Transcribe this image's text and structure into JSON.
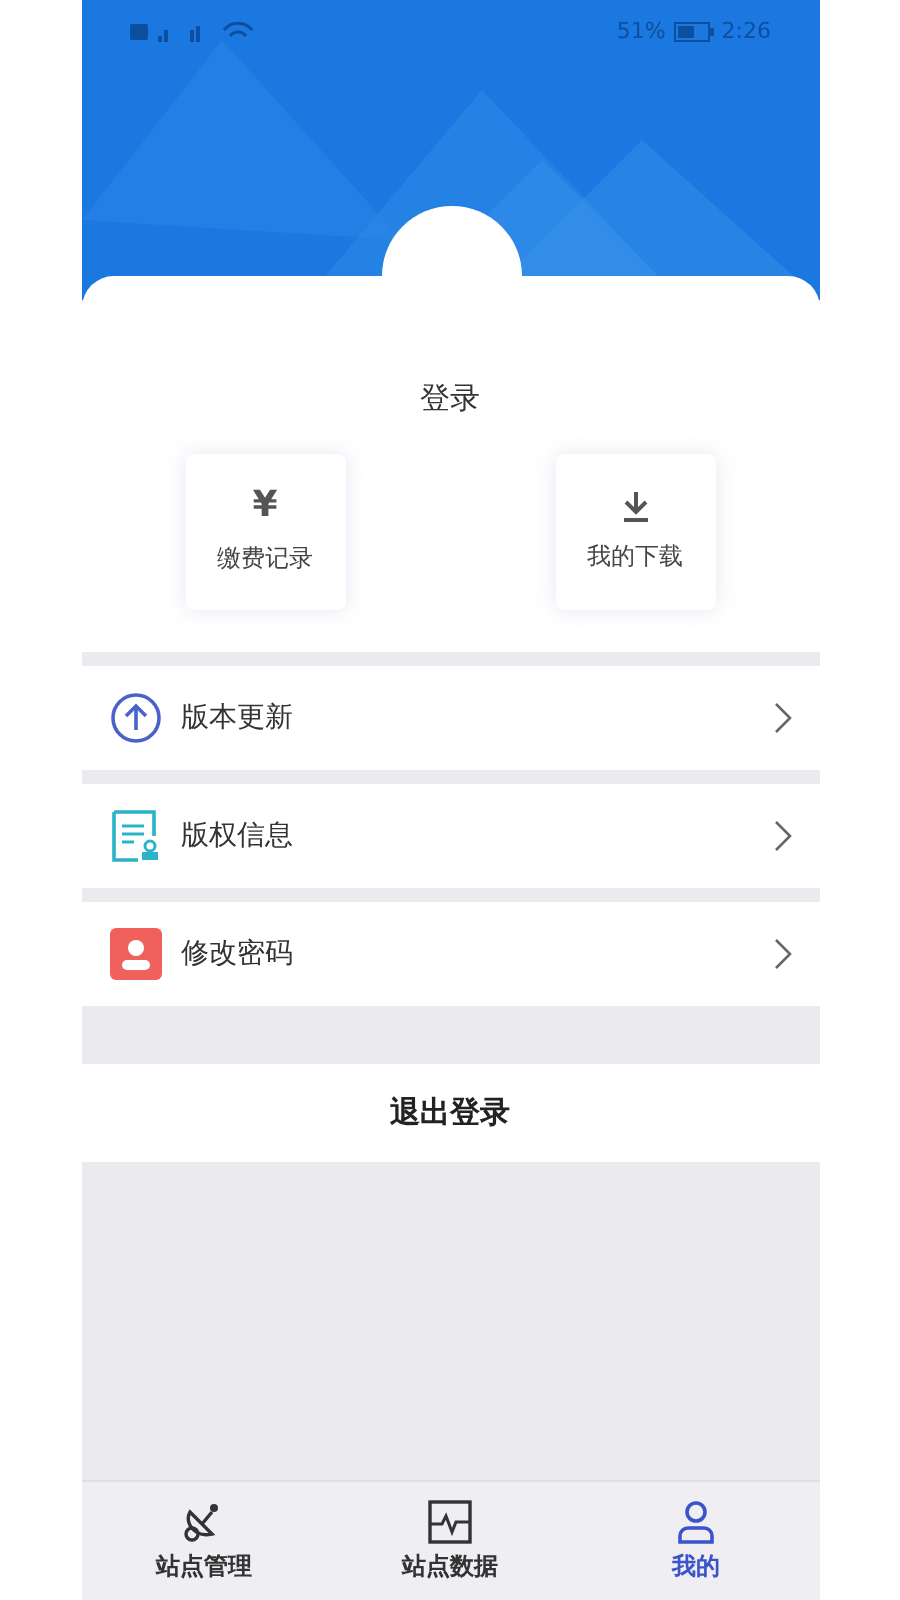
{
  "status_bar": {
    "battery": "51%",
    "time": "2:26"
  },
  "profile": {
    "login": "登录"
  },
  "shortcuts": [
    {
      "kind": "yuan",
      "icon": "¥",
      "label": "缴费记录"
    },
    {
      "kind": "download",
      "label": "我的下载"
    }
  ],
  "menu": [
    {
      "kind": "update",
      "label": "版本更新"
    },
    {
      "kind": "copyright",
      "label": "版权信息"
    },
    {
      "kind": "password",
      "label": "修改密码"
    }
  ],
  "logout": "退出登录",
  "tabs": [
    {
      "kind": "dish",
      "label": "站点管理",
      "selected": false
    },
    {
      "kind": "chart",
      "label": "站点数据",
      "selected": false
    },
    {
      "kind": "user",
      "label": "我的",
      "selected": true
    }
  ]
}
